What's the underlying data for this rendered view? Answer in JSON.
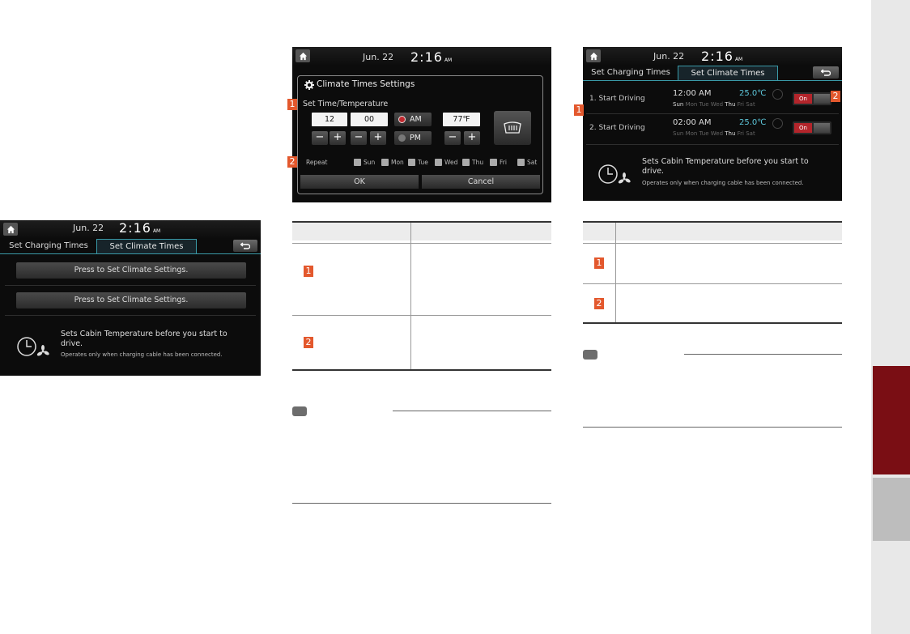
{
  "status_bar": {
    "date": "Jun. 22",
    "time": "2:16",
    "meridiem": "AM"
  },
  "screen_left": {
    "tabs": [
      "Set Charging Times",
      "Set Climate Times"
    ],
    "press_buttons": [
      "Press to Set Climate Settings.",
      "Press to Set Climate Settings."
    ],
    "info_text": "Sets Cabin Temperature before you start to drive.",
    "info_note": "Operates only when charging cable has been connected."
  },
  "screen_middle": {
    "dialog_title": "Climate Times Settings",
    "set_label": "Set Time/Temperature",
    "hour": "12",
    "minute": "00",
    "am_label": "AM",
    "pm_label": "PM",
    "temperature": "77℉",
    "minus": "−",
    "plus": "+",
    "repeat_label": "Repeat",
    "days": [
      "Sun",
      "Mon",
      "Tue",
      "Wed",
      "Thu",
      "Fri",
      "Sat"
    ],
    "ok_label": "OK",
    "cancel_label": "Cancel"
  },
  "screen_right": {
    "tabs": [
      "Set Charging Times",
      "Set Climate Times"
    ],
    "rows": [
      {
        "title": "1. Start Driving",
        "time": "12:00 AM",
        "temp": "25.0℃",
        "days": [
          "Sun",
          "Mon",
          "Tue",
          "Wed",
          "Thu",
          "Fri",
          "Sat"
        ],
        "toggle": "On"
      },
      {
        "title": "2. Start Driving",
        "time": "02:00 AM",
        "temp": "25.0℃",
        "days": [
          "Sun",
          "Mon",
          "Tue",
          "Wed",
          "Thu",
          "Fri",
          "Sat"
        ],
        "toggle": "On"
      }
    ],
    "info_text": "Sets Cabin Temperature before you start to drive.",
    "info_note": "Operates only when charging cable has been connected."
  },
  "callouts": {
    "one": "1",
    "two": "2"
  },
  "colors": {
    "accent_teal": "#3a9aa8",
    "callout_orange": "#e3582d",
    "side_tab_red": "#7a0e14"
  }
}
